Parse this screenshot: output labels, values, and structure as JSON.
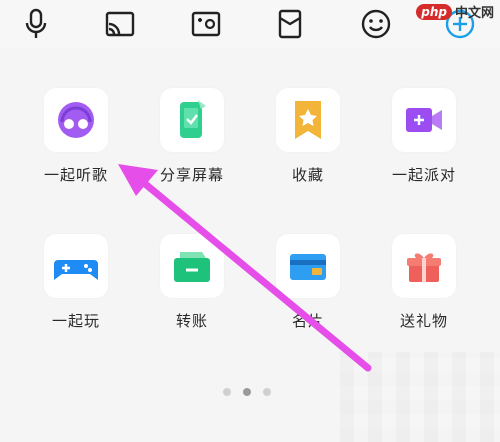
{
  "toolbar": {
    "icons": [
      "microphone-icon",
      "cast-screen-icon",
      "photo-album-icon",
      "red-packet-icon",
      "emoji-icon",
      "plus-icon"
    ]
  },
  "grid": {
    "row1": [
      {
        "label": "一起听歌",
        "icon": "listen-together-icon"
      },
      {
        "label": "分享屏幕",
        "icon": "share-screen-icon"
      },
      {
        "label": "收藏",
        "icon": "favorites-icon"
      },
      {
        "label": "一起派对",
        "icon": "party-together-icon"
      }
    ],
    "row2": [
      {
        "label": "一起玩",
        "icon": "gamepad-icon"
      },
      {
        "label": "转账",
        "icon": "transfer-icon"
      },
      {
        "label": "名片",
        "icon": "business-card-icon"
      },
      {
        "label": "送礼物",
        "icon": "gift-icon"
      }
    ]
  },
  "pager": {
    "count": 3,
    "active_index": 1
  },
  "watermark": {
    "logo": "php",
    "text": "中文网"
  },
  "colors": {
    "arrow": "#e54ee8",
    "music_purple": "#a35cf2",
    "share_green": "#2fcf8f",
    "fav_yellow": "#f2b53a",
    "party_purple": "#9b4df2",
    "game_blue": "#1f8cf5",
    "transfer_green": "#1fc27a",
    "card_blue": "#2e9ef2",
    "gift_red": "#f0605a"
  }
}
